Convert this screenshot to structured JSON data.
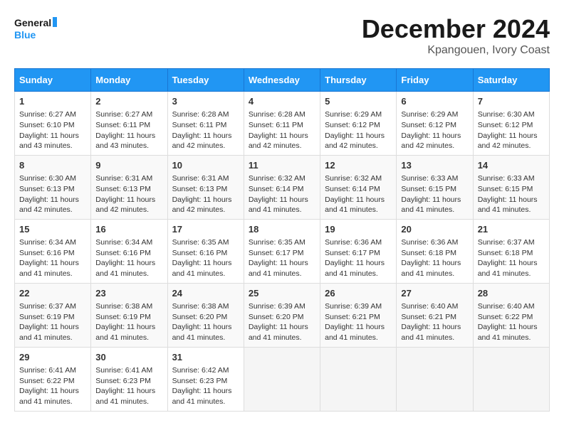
{
  "header": {
    "logo_line1": "General",
    "logo_line2": "Blue",
    "month": "December 2024",
    "location": "Kpangouen, Ivory Coast"
  },
  "weekdays": [
    "Sunday",
    "Monday",
    "Tuesday",
    "Wednesday",
    "Thursday",
    "Friday",
    "Saturday"
  ],
  "weeks": [
    [
      {
        "day": "1",
        "info": "Sunrise: 6:27 AM\nSunset: 6:10 PM\nDaylight: 11 hours\nand 43 minutes."
      },
      {
        "day": "2",
        "info": "Sunrise: 6:27 AM\nSunset: 6:11 PM\nDaylight: 11 hours\nand 43 minutes."
      },
      {
        "day": "3",
        "info": "Sunrise: 6:28 AM\nSunset: 6:11 PM\nDaylight: 11 hours\nand 42 minutes."
      },
      {
        "day": "4",
        "info": "Sunrise: 6:28 AM\nSunset: 6:11 PM\nDaylight: 11 hours\nand 42 minutes."
      },
      {
        "day": "5",
        "info": "Sunrise: 6:29 AM\nSunset: 6:12 PM\nDaylight: 11 hours\nand 42 minutes."
      },
      {
        "day": "6",
        "info": "Sunrise: 6:29 AM\nSunset: 6:12 PM\nDaylight: 11 hours\nand 42 minutes."
      },
      {
        "day": "7",
        "info": "Sunrise: 6:30 AM\nSunset: 6:12 PM\nDaylight: 11 hours\nand 42 minutes."
      }
    ],
    [
      {
        "day": "8",
        "info": "Sunrise: 6:30 AM\nSunset: 6:13 PM\nDaylight: 11 hours\nand 42 minutes."
      },
      {
        "day": "9",
        "info": "Sunrise: 6:31 AM\nSunset: 6:13 PM\nDaylight: 11 hours\nand 42 minutes."
      },
      {
        "day": "10",
        "info": "Sunrise: 6:31 AM\nSunset: 6:13 PM\nDaylight: 11 hours\nand 42 minutes."
      },
      {
        "day": "11",
        "info": "Sunrise: 6:32 AM\nSunset: 6:14 PM\nDaylight: 11 hours\nand 41 minutes."
      },
      {
        "day": "12",
        "info": "Sunrise: 6:32 AM\nSunset: 6:14 PM\nDaylight: 11 hours\nand 41 minutes."
      },
      {
        "day": "13",
        "info": "Sunrise: 6:33 AM\nSunset: 6:15 PM\nDaylight: 11 hours\nand 41 minutes."
      },
      {
        "day": "14",
        "info": "Sunrise: 6:33 AM\nSunset: 6:15 PM\nDaylight: 11 hours\nand 41 minutes."
      }
    ],
    [
      {
        "day": "15",
        "info": "Sunrise: 6:34 AM\nSunset: 6:16 PM\nDaylight: 11 hours\nand 41 minutes."
      },
      {
        "day": "16",
        "info": "Sunrise: 6:34 AM\nSunset: 6:16 PM\nDaylight: 11 hours\nand 41 minutes."
      },
      {
        "day": "17",
        "info": "Sunrise: 6:35 AM\nSunset: 6:16 PM\nDaylight: 11 hours\nand 41 minutes."
      },
      {
        "day": "18",
        "info": "Sunrise: 6:35 AM\nSunset: 6:17 PM\nDaylight: 11 hours\nand 41 minutes."
      },
      {
        "day": "19",
        "info": "Sunrise: 6:36 AM\nSunset: 6:17 PM\nDaylight: 11 hours\nand 41 minutes."
      },
      {
        "day": "20",
        "info": "Sunrise: 6:36 AM\nSunset: 6:18 PM\nDaylight: 11 hours\nand 41 minutes."
      },
      {
        "day": "21",
        "info": "Sunrise: 6:37 AM\nSunset: 6:18 PM\nDaylight: 11 hours\nand 41 minutes."
      }
    ],
    [
      {
        "day": "22",
        "info": "Sunrise: 6:37 AM\nSunset: 6:19 PM\nDaylight: 11 hours\nand 41 minutes."
      },
      {
        "day": "23",
        "info": "Sunrise: 6:38 AM\nSunset: 6:19 PM\nDaylight: 11 hours\nand 41 minutes."
      },
      {
        "day": "24",
        "info": "Sunrise: 6:38 AM\nSunset: 6:20 PM\nDaylight: 11 hours\nand 41 minutes."
      },
      {
        "day": "25",
        "info": "Sunrise: 6:39 AM\nSunset: 6:20 PM\nDaylight: 11 hours\nand 41 minutes."
      },
      {
        "day": "26",
        "info": "Sunrise: 6:39 AM\nSunset: 6:21 PM\nDaylight: 11 hours\nand 41 minutes."
      },
      {
        "day": "27",
        "info": "Sunrise: 6:40 AM\nSunset: 6:21 PM\nDaylight: 11 hours\nand 41 minutes."
      },
      {
        "day": "28",
        "info": "Sunrise: 6:40 AM\nSunset: 6:22 PM\nDaylight: 11 hours\nand 41 minutes."
      }
    ],
    [
      {
        "day": "29",
        "info": "Sunrise: 6:41 AM\nSunset: 6:22 PM\nDaylight: 11 hours\nand 41 minutes."
      },
      {
        "day": "30",
        "info": "Sunrise: 6:41 AM\nSunset: 6:23 PM\nDaylight: 11 hours\nand 41 minutes."
      },
      {
        "day": "31",
        "info": "Sunrise: 6:42 AM\nSunset: 6:23 PM\nDaylight: 11 hours\nand 41 minutes."
      },
      {
        "day": "",
        "info": ""
      },
      {
        "day": "",
        "info": ""
      },
      {
        "day": "",
        "info": ""
      },
      {
        "day": "",
        "info": ""
      }
    ]
  ]
}
